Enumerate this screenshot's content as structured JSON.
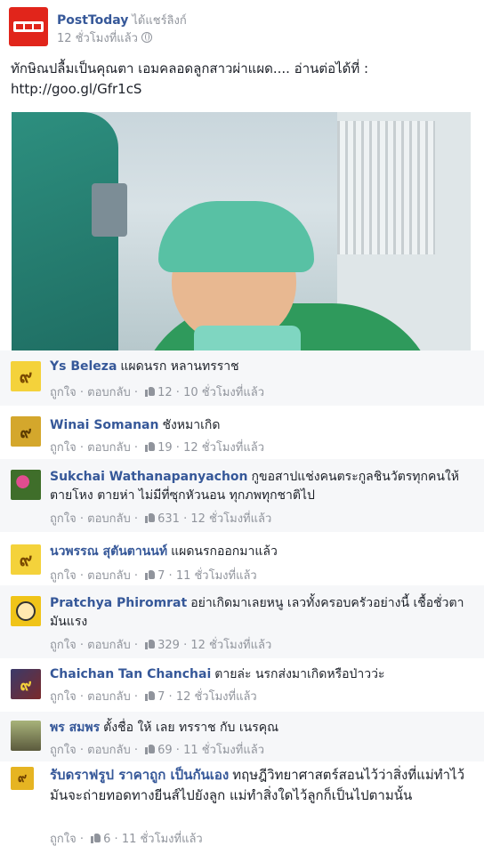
{
  "post": {
    "page_name": "PostToday",
    "shared_text": "ได้แชร์ลิงก์",
    "time": "12 ชั่วโมงที่แล้ว",
    "text": "ทักษิณปลื้มเป็นคุณตา เอมคลอดลูกสาวผ่าแผด.... อ่านต่อได้ที่ :",
    "link": "http://goo.gl/Gfr1cS",
    "logo_text": "post"
  },
  "comments": [
    {
      "name": "Ys Beleza",
      "text": "แผดนรก หลานทรราช",
      "like": "ถูกใจ",
      "reply": "ตอบกลับ",
      "likes": "12",
      "time": "10 ชั่วโมงที่แล้ว",
      "avatar": "๙"
    },
    {
      "name": "Winai Somanan",
      "text": "ชังหมาเกิด",
      "like": "ถูกใจ",
      "reply": "ตอบกลับ",
      "likes": "19",
      "time": "12 ชั่วโมงที่แล้ว",
      "avatar": "๙"
    },
    {
      "name": "Sukchai Wathanapanyachon",
      "text": "กูขอสาปแช่งคนตระกูลชินวัตรทุกคนให้ตายโหง ตายห่า ไม่มีที่ซุกหัวนอน ทุกภพทุกชาติไป",
      "like": "ถูกใจ",
      "reply": "ตอบกลับ",
      "likes": "631",
      "time": "12 ชั่วโมงที่แล้ว",
      "avatar": ""
    },
    {
      "name": "นวพรรณ สุตันตานนท์",
      "text": "แผดนรกออกมาแล้ว",
      "like": "ถูกใจ",
      "reply": "ตอบกลับ",
      "likes": "7",
      "time": "11 ชั่วโมงที่แล้ว",
      "avatar": "๙"
    },
    {
      "name": "Pratchya Phiromrat",
      "text": "อย่าเกิดมาเลยหนู เลวทั้งครอบครัวอย่างนี้ เชื้อชั่วตามันแรง",
      "like": "ถูกใจ",
      "reply": "ตอบกลับ",
      "likes": "329",
      "time": "12 ชั่วโมงที่แล้ว",
      "avatar": ""
    },
    {
      "name": "Chaichan Tan Chanchai",
      "text": "ตายล่ะ นรกส่งมาเกิดหรือป่าวว่ะ",
      "like": "ถูกใจ",
      "reply": "ตอบกลับ",
      "likes": "7",
      "time": "12 ชั่วโมงที่แล้ว",
      "avatar": "๙"
    },
    {
      "name": "พร สมพร",
      "text": "ตั้งชื่อ ให้ เลย ทรราช กับ เนรคุณ",
      "like": "ถูกใจ",
      "reply": "ตอบกลับ",
      "likes": "69",
      "time": "11 ชั่วโมงที่แล้ว",
      "avatar": ""
    },
    {
      "name": "รับดราฟรูป ราคาถูก เป็นกันเอง",
      "text": "ทฤษฎีวิทยาศาสตร์สอนไว้ว่าสิ่งที่แม่ทำไว้มันจะถ่ายทอดทางยีนส์ไปยังลูก แม่ทำสิ่งใดไว้ลูกก็เป็นไปตามนั้น",
      "like": "ถูกใจ",
      "reply": "",
      "likes": "6",
      "time": "11 ชั่วโมงที่แล้ว",
      "avatar": "๙"
    }
  ]
}
